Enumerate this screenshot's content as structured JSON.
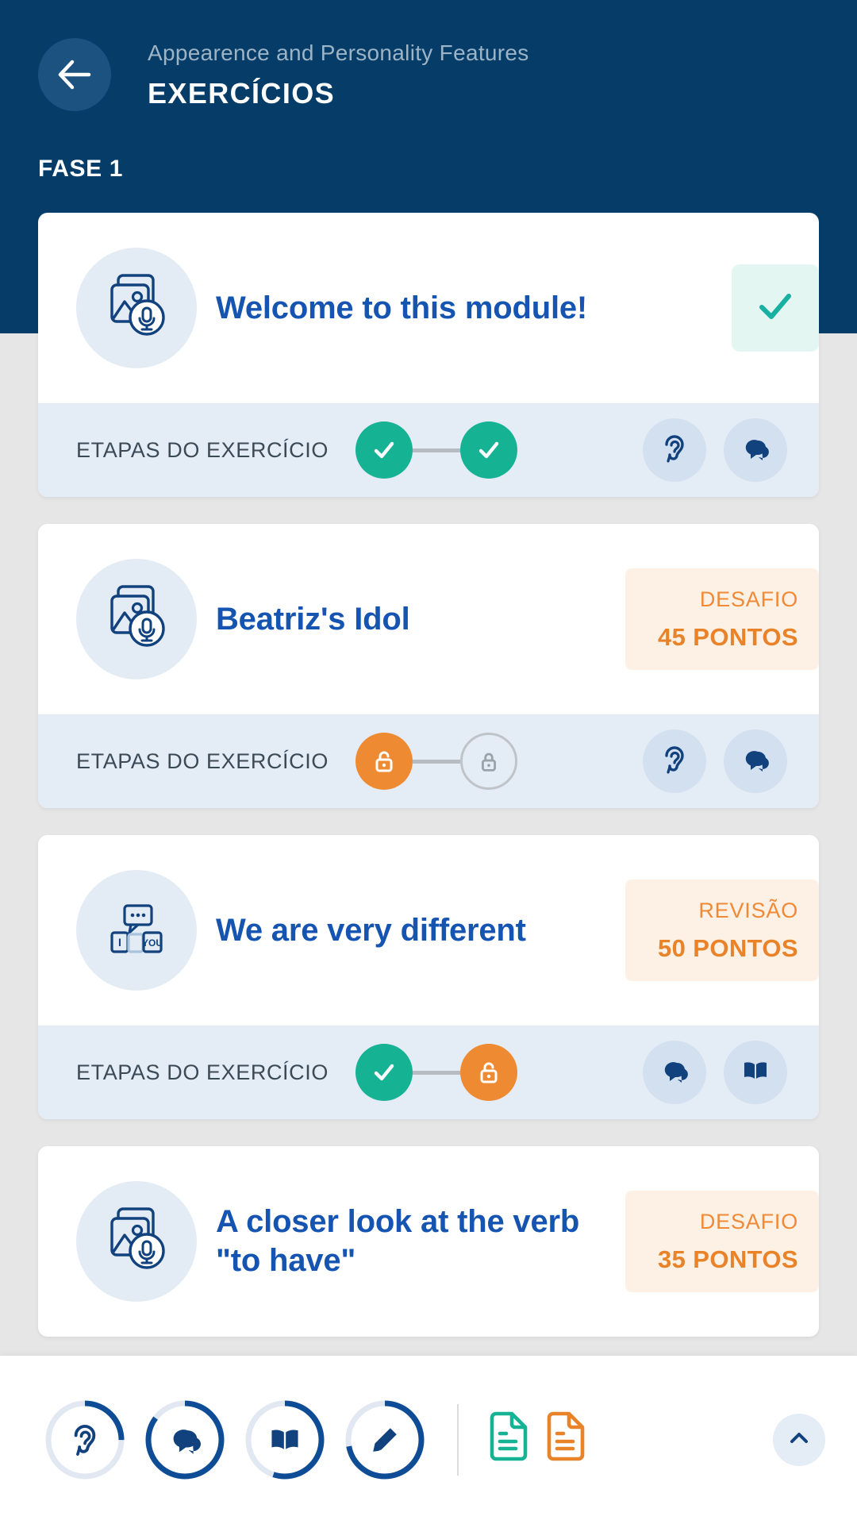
{
  "header": {
    "back_icon": "arrow-left-icon",
    "subtitle": "Appearence and Personality Features",
    "title": "EXERCÍCIOS",
    "phase": "FASE 1",
    "bg_color": "#053d68"
  },
  "steps_label": "ETAPAS DO EXERCÍCIO",
  "colors": {
    "navy": "#053d68",
    "blue": "#1554b0",
    "orange": "#e8832a",
    "teal": "#16b294",
    "badge_bg": "#fdf0e4",
    "steps_bg": "#e4ecf6",
    "page_bg": "#e6e6e6"
  },
  "exercises": [
    {
      "title": "Welcome to this module!",
      "thumb_icon": "image-audio-icon",
      "status": "completed",
      "badge": null,
      "steps": [
        "done",
        "done"
      ],
      "skills": [
        "ear-icon",
        "speech-bubble-icon"
      ]
    },
    {
      "title": "Beatriz's Idol",
      "thumb_icon": "image-audio-icon",
      "status": "available",
      "badge": {
        "kind": "DESAFIO",
        "points": "45 PONTOS"
      },
      "steps": [
        "open",
        "locked"
      ],
      "skills": [
        "ear-icon",
        "speech-bubble-icon"
      ]
    },
    {
      "title": "We are very different",
      "thumb_icon": "dialogue-cards-icon",
      "status": "available",
      "badge": {
        "kind": "REVISÃO",
        "points": "50 PONTOS"
      },
      "steps": [
        "done",
        "open"
      ],
      "skills": [
        "speech-bubble-icon",
        "book-icon"
      ]
    },
    {
      "title": "A closer look at the verb \"to have\"",
      "thumb_icon": "image-audio-icon",
      "status": "available",
      "badge": {
        "kind": "DESAFIO",
        "points": "35 PONTOS"
      },
      "steps": [],
      "skills": []
    }
  ],
  "bottom_bar": {
    "skill_rings": [
      {
        "icon": "ear-icon",
        "progress": 25
      },
      {
        "icon": "speech-bubble-icon",
        "progress": 85
      },
      {
        "icon": "book-icon",
        "progress": 55
      },
      {
        "icon": "pencil-icon",
        "progress": 72
      }
    ],
    "documents": [
      {
        "icon": "document-icon",
        "color": "#16b294"
      },
      {
        "icon": "document-icon",
        "color": "#e8832a"
      }
    ],
    "collapse_icon": "chevron-up-icon"
  }
}
